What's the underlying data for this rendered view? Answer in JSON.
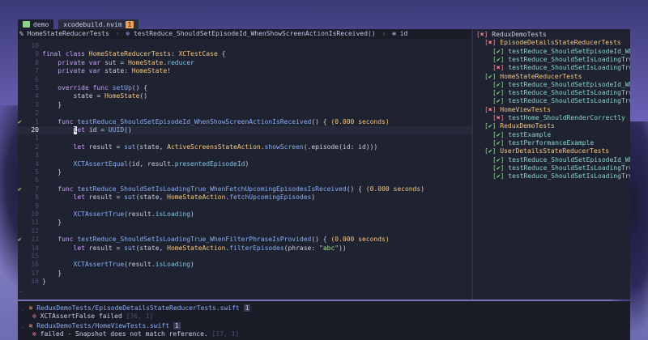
{
  "tabs": [
    {
      "label": "demo",
      "icon": "terminal-icon"
    },
    {
      "label": "xcodebuild.nvim",
      "count": "1"
    }
  ],
  "breadcrumb": {
    "file": "HomeStateReducerTests",
    "symbol": "testReduce_ShouldSetEpisodeId_WhenShowScreenActionIsReceived()",
    "var": "id"
  },
  "editor": {
    "lines": [
      {
        "n": "10",
        "g": "",
        "c": []
      },
      {
        "n": "9",
        "g": "",
        "c": [
          [
            "k",
            "final class "
          ],
          [
            "t",
            "HomeStateReducerTests"
          ],
          [
            "n",
            ": "
          ],
          [
            "t",
            "XCTestCase"
          ],
          [
            "n",
            " {"
          ]
        ]
      },
      {
        "n": "8",
        "g": "",
        "c": [
          [
            "k",
            "    private var "
          ],
          [
            "n",
            "sut = "
          ],
          [
            "t",
            "HomeState"
          ],
          [
            "n",
            "."
          ],
          [
            "p",
            "reducer"
          ]
        ]
      },
      {
        "n": "7",
        "g": "",
        "c": [
          [
            "k",
            "    private var "
          ],
          [
            "n",
            "state: "
          ],
          [
            "t",
            "HomeState"
          ],
          [
            "n",
            "!"
          ]
        ]
      },
      {
        "n": "6",
        "g": "",
        "c": []
      },
      {
        "n": "5",
        "g": "",
        "c": [
          [
            "k",
            "    override func "
          ],
          [
            "f",
            "setUp"
          ],
          [
            "n",
            "() {"
          ]
        ]
      },
      {
        "n": "4",
        "g": "",
        "c": [
          [
            "n",
            "        state = "
          ],
          [
            "t",
            "HomeState"
          ],
          [
            "n",
            "()"
          ]
        ]
      },
      {
        "n": "3",
        "g": "",
        "c": [
          [
            "n",
            "    }"
          ]
        ]
      },
      {
        "n": "2",
        "g": "",
        "c": []
      },
      {
        "n": "1",
        "g": "✔",
        "c": [
          [
            "k",
            "    func "
          ],
          [
            "f",
            "testReduce_ShouldSetEpisodeId_WhenShowScreenActionIsReceived"
          ],
          [
            "n",
            "() { "
          ],
          [
            "t",
            "(0.000 seconds)"
          ]
        ]
      },
      {
        "n": "20",
        "g": "",
        "cur": true,
        "c": [
          [
            "k",
            "        "
          ],
          [
            "cur",
            "l"
          ],
          [
            "k",
            "et "
          ],
          [
            "n",
            "id = "
          ],
          [
            "f",
            "UUID"
          ],
          [
            "n",
            "()"
          ]
        ]
      },
      {
        "n": "1",
        "g": "",
        "c": []
      },
      {
        "n": "2",
        "g": "",
        "c": [
          [
            "k",
            "        let "
          ],
          [
            "n",
            "result = "
          ],
          [
            "f",
            "sut"
          ],
          [
            "n",
            "(state, "
          ],
          [
            "t",
            "ActiveScreensStateAction"
          ],
          [
            "n",
            "."
          ],
          [
            "f",
            "showScreen"
          ],
          [
            "n",
            "(.episode(id: id)))"
          ]
        ]
      },
      {
        "n": "3",
        "g": "",
        "c": []
      },
      {
        "n": "4",
        "g": "",
        "c": [
          [
            "f",
            "        XCTAssertEqual"
          ],
          [
            "n",
            "(id, result."
          ],
          [
            "p",
            "presentedEpisodeId"
          ],
          [
            "n",
            ")"
          ]
        ]
      },
      {
        "n": "5",
        "g": "",
        "c": [
          [
            "n",
            "    }"
          ]
        ]
      },
      {
        "n": "6",
        "g": "",
        "c": []
      },
      {
        "n": "7",
        "g": "✔",
        "c": [
          [
            "k",
            "    func "
          ],
          [
            "f",
            "testReduce_ShouldSetIsLoadingTrue_WhenFetchUpcomingEpisodesIsReceived"
          ],
          [
            "n",
            "() { "
          ],
          [
            "t",
            "(0.000 seconds)"
          ]
        ]
      },
      {
        "n": "8",
        "g": "",
        "c": [
          [
            "k",
            "        let "
          ],
          [
            "n",
            "result = "
          ],
          [
            "f",
            "sut"
          ],
          [
            "n",
            "(state, "
          ],
          [
            "t",
            "HomeStateAction"
          ],
          [
            "n",
            "."
          ],
          [
            "f",
            "fetchUpcomingEpisodes"
          ],
          [
            "n",
            ")"
          ]
        ]
      },
      {
        "n": "9",
        "g": "",
        "c": []
      },
      {
        "n": "10",
        "g": "",
        "c": [
          [
            "f",
            "        XCTAssertTrue"
          ],
          [
            "n",
            "(result."
          ],
          [
            "p",
            "isLoading"
          ],
          [
            "n",
            ")"
          ]
        ]
      },
      {
        "n": "11",
        "g": "",
        "c": [
          [
            "n",
            "    }"
          ]
        ]
      },
      {
        "n": "12",
        "g": "",
        "c": []
      },
      {
        "n": "13",
        "g": "✔",
        "c": [
          [
            "k",
            "    func "
          ],
          [
            "f",
            "testReduce_ShouldSetIsLoadingTrue_WhenFilterPhraseIsProvided"
          ],
          [
            "n",
            "() { "
          ],
          [
            "t",
            "(0.000 seconds)"
          ]
        ]
      },
      {
        "n": "14",
        "g": "",
        "c": [
          [
            "k",
            "        let "
          ],
          [
            "n",
            "result = "
          ],
          [
            "f",
            "sut"
          ],
          [
            "n",
            "(state, "
          ],
          [
            "t",
            "HomeStateAction"
          ],
          [
            "n",
            "."
          ],
          [
            "f",
            "filterEpisodes"
          ],
          [
            "n",
            "(phrase: "
          ],
          [
            "s",
            "\"abc\""
          ],
          [
            "n",
            "))"
          ]
        ]
      },
      {
        "n": "15",
        "g": "",
        "c": []
      },
      {
        "n": "16",
        "g": "",
        "c": [
          [
            "f",
            "        XCTAssertTrue"
          ],
          [
            "n",
            "(result."
          ],
          [
            "p",
            "isLoading"
          ],
          [
            "n",
            ")"
          ]
        ]
      },
      {
        "n": "17",
        "g": "",
        "c": [
          [
            "n",
            "    }"
          ]
        ]
      },
      {
        "n": "18",
        "g": "",
        "c": [
          [
            "n",
            "}"
          ]
        ]
      }
    ],
    "tilde": "~"
  },
  "tests": [
    {
      "indent": 0,
      "status": "bad",
      "mark": "[✖]",
      "label": "ReduxDemoTests",
      "kind": "root"
    },
    {
      "indent": 1,
      "status": "bad",
      "mark": "[✖]",
      "label": "EpisodeDetailsStateReducerTests",
      "kind": "class"
    },
    {
      "indent": 2,
      "status": "ok",
      "mark": "[✔]",
      "label": "testReduce_ShouldSetEpisodeId_When",
      "kind": "test"
    },
    {
      "indent": 2,
      "status": "ok",
      "mark": "[✔]",
      "label": "testReduce_ShouldSetIsLoadingTrue_",
      "kind": "test"
    },
    {
      "indent": 2,
      "status": "bad",
      "mark": "[✖]",
      "label": "testReduce_ShouldSetIsLoadingTrue_",
      "kind": "test"
    },
    {
      "indent": 1,
      "status": "ok",
      "mark": "[✔]",
      "label": "HomeStateReducerTests",
      "kind": "class"
    },
    {
      "indent": 2,
      "status": "ok",
      "mark": "[✔]",
      "label": "testReduce_ShouldSetEpisodeId_When",
      "kind": "test"
    },
    {
      "indent": 2,
      "status": "ok",
      "mark": "[✔]",
      "label": "testReduce_ShouldSetIsLoadingTrue_",
      "kind": "test"
    },
    {
      "indent": 2,
      "status": "ok",
      "mark": "[✔]",
      "label": "testReduce_ShouldSetIsLoadingTrue_",
      "kind": "test"
    },
    {
      "indent": 1,
      "status": "bad",
      "mark": "[✖]",
      "label": "HomeViewTests",
      "kind": "class"
    },
    {
      "indent": 2,
      "status": "bad",
      "mark": "[✖]",
      "label": "testHome_ShouldRenderCorrectly",
      "kind": "test"
    },
    {
      "indent": 1,
      "status": "ok",
      "mark": "[✔]",
      "label": "ReduxDemoTests",
      "kind": "class"
    },
    {
      "indent": 2,
      "status": "ok",
      "mark": "[✔]",
      "label": "testExample",
      "kind": "test"
    },
    {
      "indent": 2,
      "status": "ok",
      "mark": "[✔]",
      "label": "testPerformanceExample",
      "kind": "test"
    },
    {
      "indent": 1,
      "status": "ok",
      "mark": "[✔]",
      "label": "UserDetailsStateReducerTests",
      "kind": "class"
    },
    {
      "indent": 2,
      "status": "ok",
      "mark": "[✔]",
      "label": "testReduce_ShouldSetEpisodeId_When",
      "kind": "test"
    },
    {
      "indent": 2,
      "status": "ok",
      "mark": "[✔]",
      "label": "testReduce_ShouldSetIsLoadingTrue_",
      "kind": "test"
    },
    {
      "indent": 2,
      "status": "ok",
      "mark": "[✔]",
      "label": "testReduce_ShouldSetIsLoadingTrue_",
      "kind": "test"
    }
  ],
  "diagnostics": [
    {
      "file": "ReduxDemoTests/EpisodeDetailsStateReducerTests.swift",
      "count": "1",
      "msg": "XCTAssertFalse failed",
      "pos": "[36, 1]"
    },
    {
      "file": "ReduxDemoTests/HomeViewTests.swift",
      "count": "1",
      "msg": "failed - Snapshot does not match reference.",
      "pos": "[17, 1]"
    }
  ]
}
